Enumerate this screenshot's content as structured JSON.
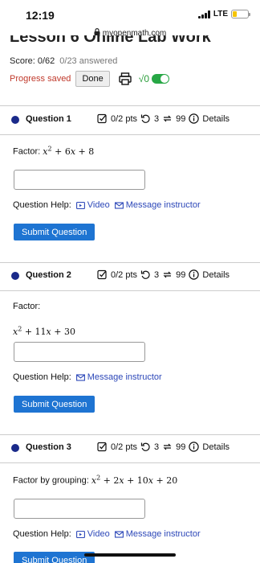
{
  "status": {
    "time": "12:19",
    "network": "LTE"
  },
  "browser": {
    "url": "myopenmath.com"
  },
  "page": {
    "title": "Lesson 6 Online Lab Work",
    "score_label": "Score: 0/62",
    "answered": "0/23 answered",
    "progress_saved": "Progress saved",
    "done_label": "Done",
    "sqrt_label": "√0"
  },
  "questions": [
    {
      "title": "Question 1",
      "pts": "0/2 pts",
      "retries": "3",
      "attempts": "99",
      "details": "Details",
      "prompt": "Factor:",
      "expr_html": "x<sup>2</sup> <span class='n'>+ 6</span>x <span class='n'>+ 8</span>",
      "help_label": "Question Help:",
      "video_label": "Video",
      "message_label": "Message instructor",
      "submit_label": "Submit Question"
    },
    {
      "title": "Question 2",
      "pts": "0/2 pts",
      "retries": "3",
      "attempts": "99",
      "details": "Details",
      "prompt": "Factor:",
      "expr_html": "x<sup>2</sup> <span class='n'>+ 11</span>x <span class='n'>+ 30</span>",
      "help_label": "Question Help:",
      "message_label": "Message instructor",
      "submit_label": "Submit Question"
    },
    {
      "title": "Question 3",
      "pts": "0/2 pts",
      "retries": "3",
      "attempts": "99",
      "details": "Details",
      "prompt": "Factor by grouping:",
      "expr_html": "x<sup>2</sup> <span class='n'>+ 2</span>x <span class='n'>+ 10</span>x <span class='n'>+ 20</span>",
      "help_label": "Question Help:",
      "video_label": "Video",
      "message_label": "Message instructor",
      "submit_label": "Submit Question"
    }
  ]
}
